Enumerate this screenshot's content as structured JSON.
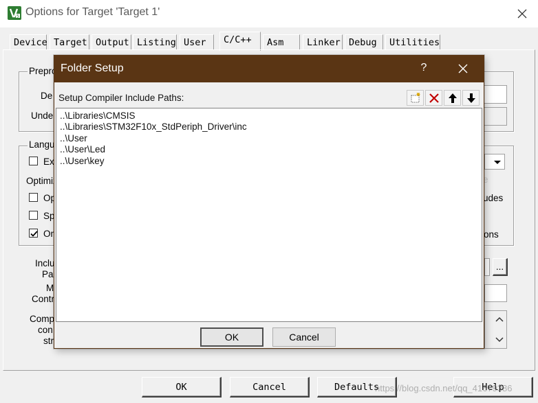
{
  "window": {
    "title": "Options for Target 'Target 1'",
    "tabs": [
      "Device",
      "Target",
      "Output",
      "Listing",
      "User",
      "C/C++",
      "Asm",
      "Linker",
      "Debug",
      "Utilities"
    ],
    "active_tab": "C/C++",
    "background_fragments": {
      "preprocessor_group": "Prepro",
      "define_label": "De",
      "undefine_label": "Unde",
      "language_group": "Langu",
      "execute_only_label": "Ex",
      "optimization_label": "Optimiz",
      "opt_row1_label": "Op",
      "opt_row2_label": "Sp",
      "opt_row3_label": "On",
      "right_frag_e": "e",
      "right_frag_udes": "udes",
      "right_frag_ons": "ons",
      "include_paths_label_1": "Inclu",
      "include_paths_label_2": "Pa",
      "misc_controls_label_1": "M",
      "misc_controls_label_2": "Contr",
      "compiler_string_label_1": "Comp",
      "compiler_string_label_2": "con",
      "compiler_string_label_3": "str",
      "browse_button": "..."
    },
    "checkboxes": {
      "execute_only": false,
      "opt_row1": false,
      "opt_row2": false,
      "opt_row3": true
    },
    "footer_buttons": {
      "ok": "OK",
      "cancel": "Cancel",
      "defaults": "Defaults",
      "help": "Help"
    },
    "watermark": "https://blog.csdn.net/qq_41679386"
  },
  "dialog": {
    "title": "Folder Setup",
    "help_label": "?",
    "list_header": "Setup Compiler Include Paths:",
    "toolbar_icons": [
      "new-folder-icon",
      "delete-icon",
      "move-up-icon",
      "move-down-icon"
    ],
    "paths": [
      "..\\Libraries\\CMSIS",
      "..\\Libraries\\STM32F10x_StdPeriph_Driver\\inc",
      "..\\User",
      "..\\User\\Led",
      "..\\User\\key"
    ],
    "ok_label": "OK",
    "cancel_label": "Cancel"
  },
  "colors": {
    "dialog_title_bar": "#5a3514",
    "window_background": "#f0f0f0",
    "delete_icon": "#c00000",
    "app_icon": "#2e7d32"
  }
}
